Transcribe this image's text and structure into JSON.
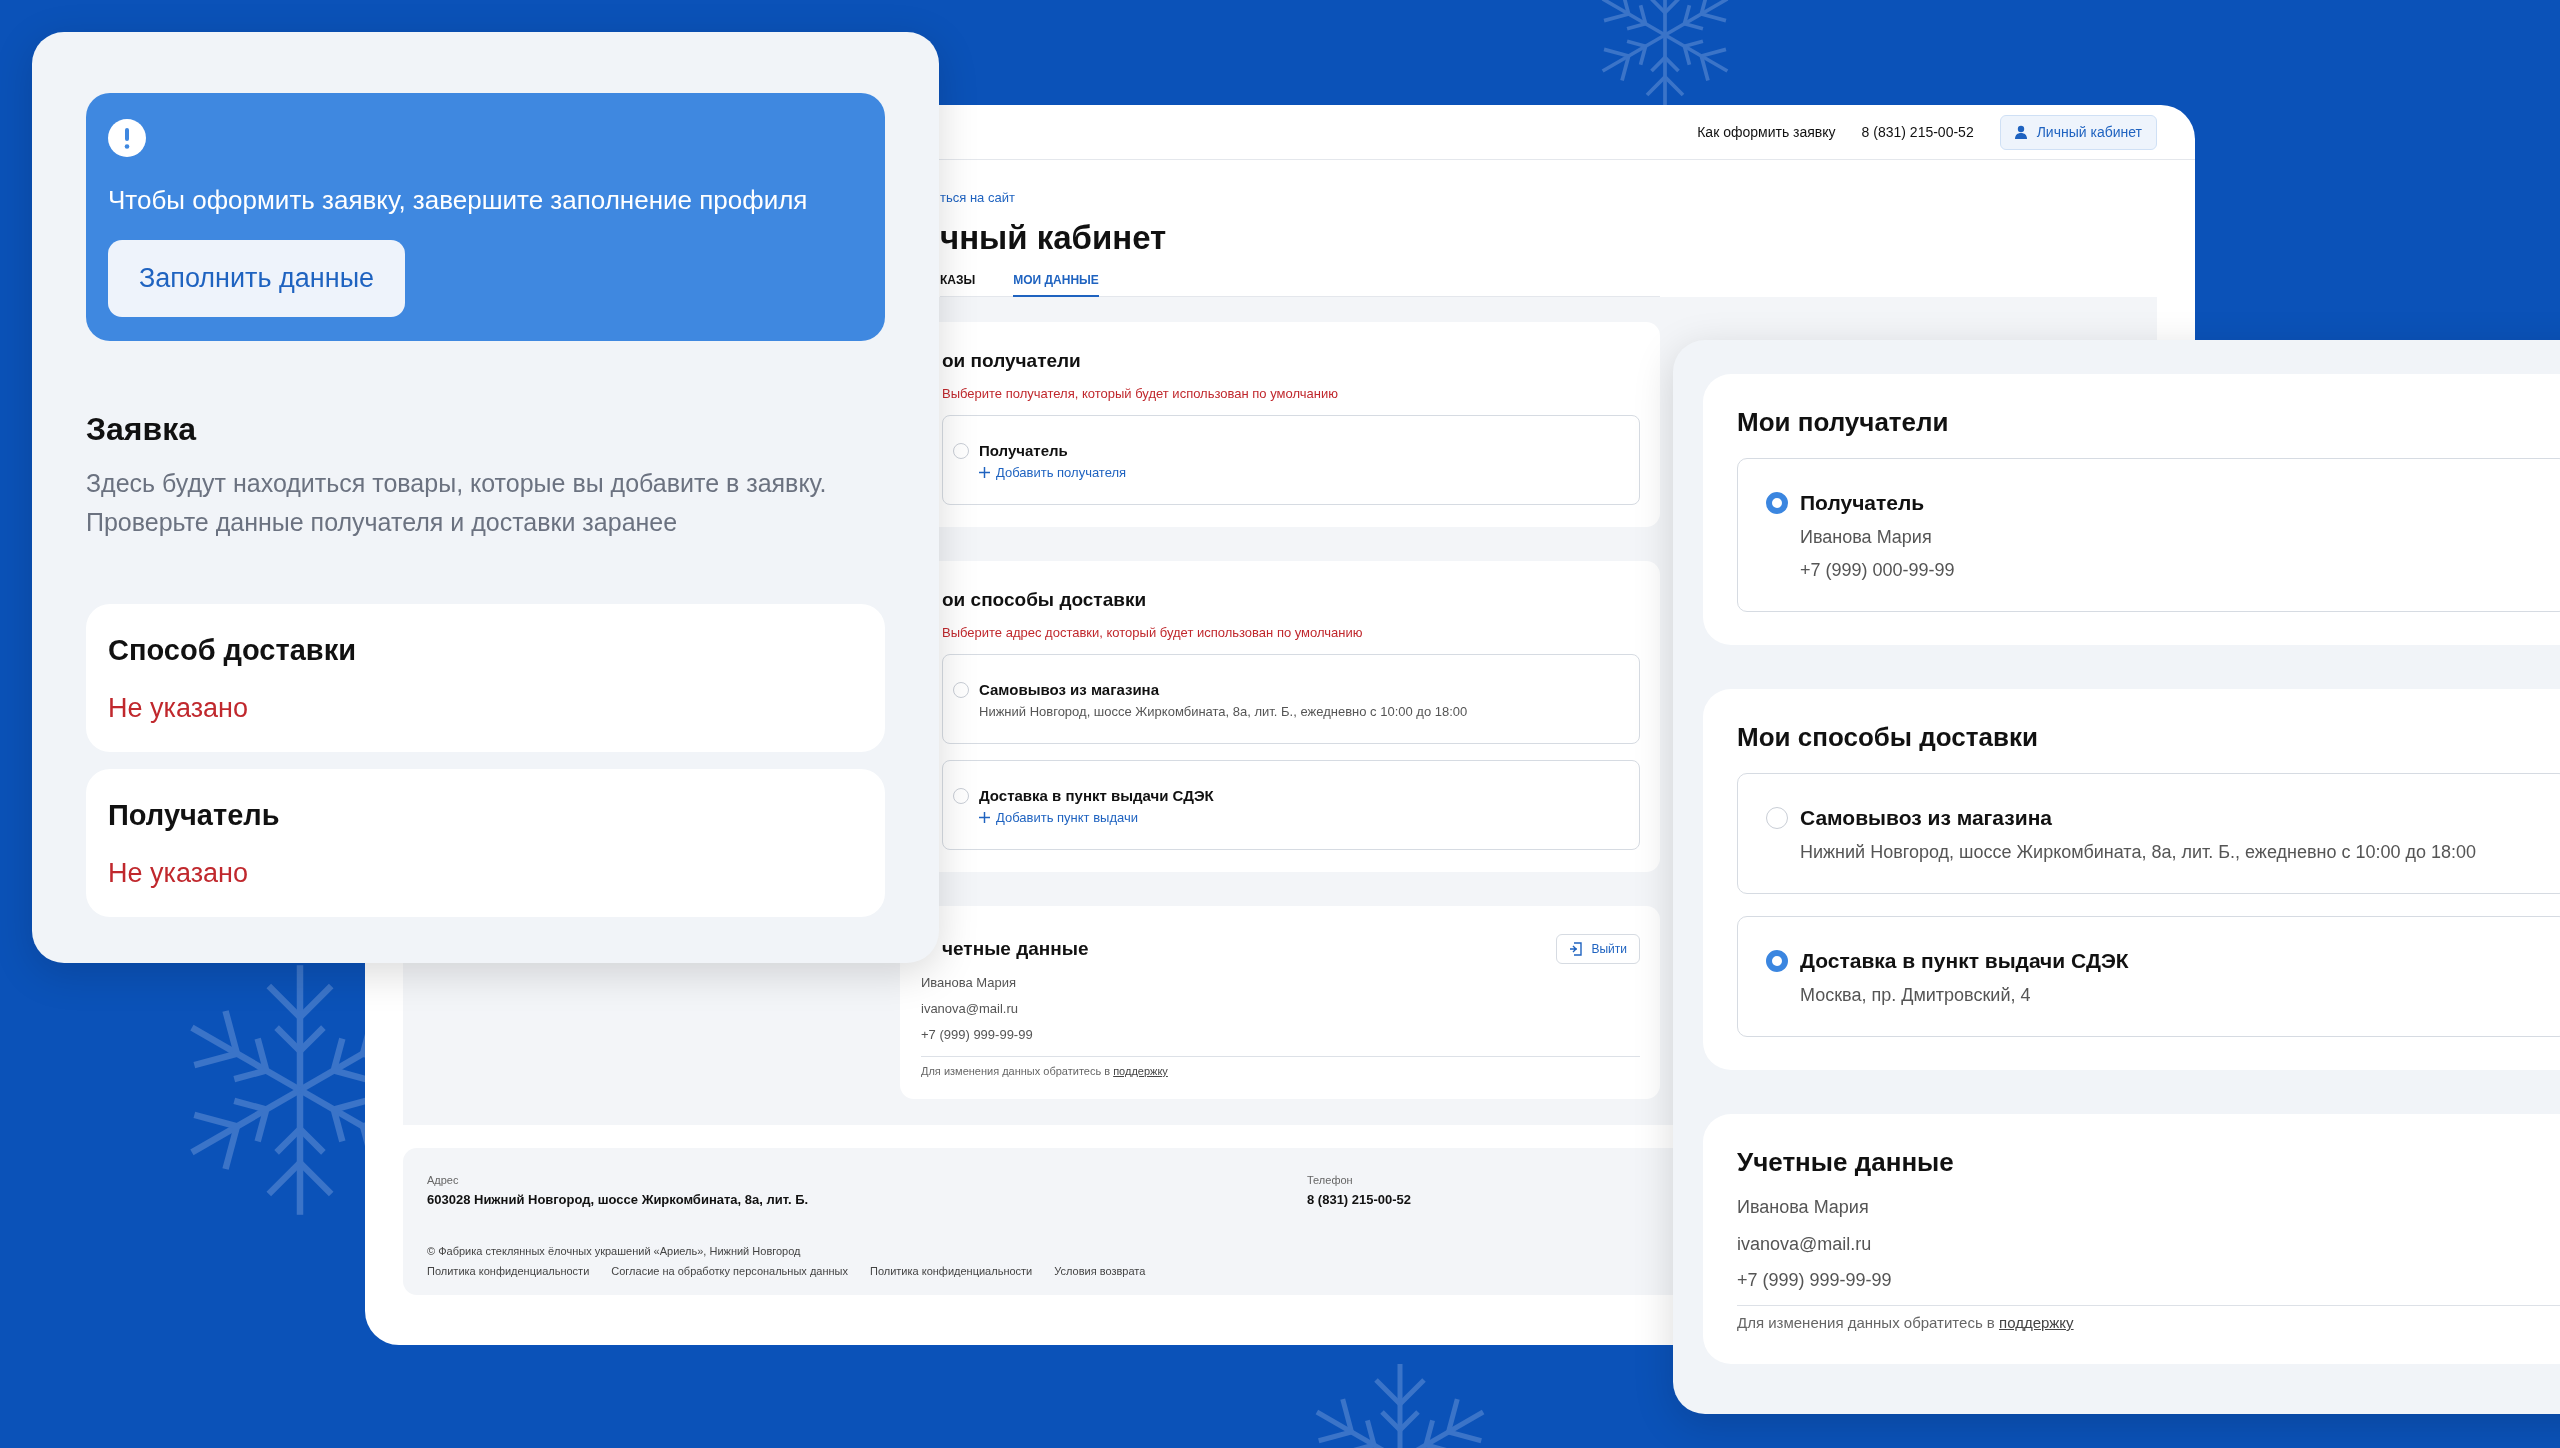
{
  "left_panel": {
    "alert": {
      "message": "Чтобы оформить заявку, завершите заполнение профиля",
      "button": "Заполнить данные"
    },
    "order": {
      "title": "Заявка",
      "description": "Здесь будут находиться товары, которые вы добавите в заявку. Проверьте данные получателя и доставки заранее"
    },
    "summary": [
      {
        "title": "Способ доставки",
        "value": "Не указано"
      },
      {
        "title": "Получатель",
        "value": "Не указано"
      }
    ]
  },
  "site": {
    "header": {
      "links": [
        "Как оформить заявку",
        "8 (831) 215-00-52"
      ],
      "account_button": "Личный кабинет"
    },
    "back_link": "ться на сайт",
    "page_title": "чный кабинет",
    "tabs": [
      {
        "label": "КАЗЫ",
        "selected": false
      },
      {
        "label": "МОИ ДАННЫЕ",
        "selected": true
      }
    ],
    "recipients": {
      "title": "ои получатели",
      "hint": "Выберите получателя, который будет использован по умолчанию",
      "options": [
        {
          "label": "Получатель",
          "selected": false,
          "action": "Добавить получателя"
        }
      ]
    },
    "delivery": {
      "title": "ои способы доставки",
      "hint": "Выберите адрес доставки, который будет использован по умолчанию",
      "options": [
        {
          "label": "Самовывоз из магазина",
          "selected": false,
          "detail": "Нижний Новгород, шоссе Жиркомбината, 8а, лит. Б., ежедневно с 10:00 до 18:00"
        },
        {
          "label": "Доставка в пункт выдачи СДЭК",
          "selected": false,
          "action": "Добавить пункт выдачи"
        }
      ]
    },
    "account": {
      "title": "четные данные",
      "logout": "Выйти",
      "lines": [
        "Иванова Мария",
        "ivanova@mail.ru",
        "+7 (999) 999-99-99"
      ],
      "note": "Для изменения данных обратитесь в",
      "note_link": "поддержку"
    },
    "footer": {
      "columns": [
        {
          "label": "Адрес",
          "value": "603028 Нижний Новгород, шоссе Жиркомбината, 8а, лит. Б."
        },
        {
          "label": "Телефон",
          "value": "8 (831) 215-00-52"
        }
      ],
      "copyright": "© Фабрика стеклянных ёлочных украшений «Ариель», Нижний Новгород",
      "links": [
        "Политика конфиденциальности",
        "Согласие на обработку персональных данных",
        "Политика конфиденциальности",
        "Условия возврата"
      ]
    }
  },
  "detail_panel": {
    "recipients": {
      "title": "Мои получатели",
      "options": [
        {
          "label": "Получатель",
          "selected": true,
          "lines": [
            "Иванова Мария",
            "+7 (999) 000-99-99"
          ]
        }
      ]
    },
    "delivery": {
      "title": "Мои способы доставки",
      "options": [
        {
          "label": "Самовывоз из магазина",
          "selected": false,
          "lines": [
            "Нижний Новгород, шоссе Жиркомбината, 8а, лит. Б., ежедневно с 10:00 до 18:00"
          ]
        },
        {
          "label": "Доставка в пункт выдачи СДЭК",
          "selected": true,
          "lines": [
            "Москва, пр. Дмитровский, 4"
          ]
        }
      ]
    },
    "account": {
      "title": "Учетные данные",
      "lines": [
        "Иванова Мария",
        "ivanova@mail.ru",
        "+7 (999) 999-99-99"
      ],
      "note": "Для изменения данных обратитесь в",
      "note_link": "поддержку"
    }
  }
}
